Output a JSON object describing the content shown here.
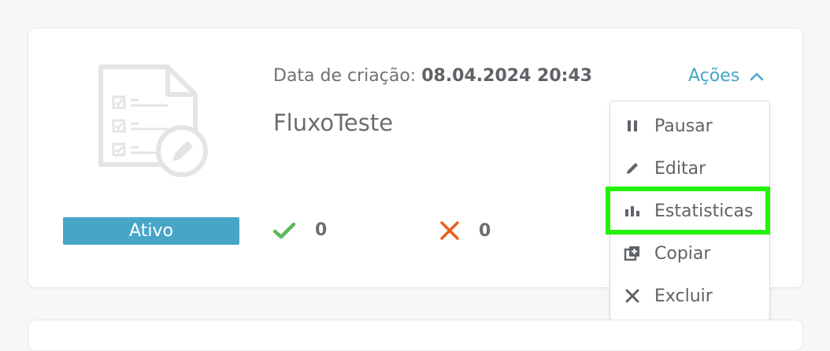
{
  "card": {
    "status": "Ativo",
    "created_label": "Data de criação:",
    "created_value": "08.04.2024 20:43",
    "flow_name": "FluxoTeste",
    "success_count": "0",
    "failure_count": "0",
    "actions_label": "Ações"
  },
  "menu": {
    "items": [
      {
        "label": "Pausar",
        "icon": "pause-icon"
      },
      {
        "label": "Editar",
        "icon": "pencil-icon"
      },
      {
        "label": "Estatisticas",
        "icon": "bar-chart-icon"
      },
      {
        "label": "Copiar",
        "icon": "copy-icon"
      },
      {
        "label": "Excluir",
        "icon": "close-icon"
      }
    ],
    "highlighted": "Estatisticas"
  },
  "colors": {
    "accent": "#47a6c8",
    "success": "#5cb85c",
    "failure": "#f05a1a",
    "highlight": "#22f20c"
  }
}
